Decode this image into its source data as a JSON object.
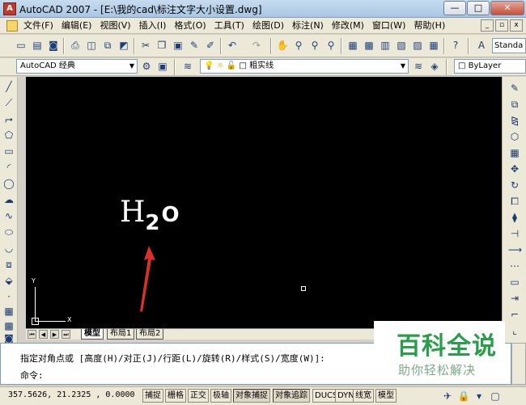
{
  "window": {
    "app_name": "AutoCAD 2007",
    "file_path": "[E:\\我的cad\\标注文字大小设置.dwg]",
    "minimize": "—",
    "maximize": "□",
    "close": "✕"
  },
  "menu": {
    "items": [
      "文件(F)",
      "编辑(E)",
      "视图(V)",
      "插入(I)",
      "格式(O)",
      "工具(T)",
      "绘图(D)",
      "标注(N)",
      "修改(M)",
      "窗口(W)",
      "帮助(H)"
    ],
    "mdi_min": "_",
    "mdi_restore": "▫",
    "mdi_close": "x"
  },
  "toolbar": {
    "text_style": "Standa",
    "workspace": "AutoCAD 经典",
    "layer": "粗实线",
    "color": "ByLayer"
  },
  "canvas": {
    "ucs_y": "Y",
    "ucs_x": "X",
    "text_big": "H",
    "text_sub": "2",
    "text_o": "O",
    "arrow_color": "#d9302a",
    "background": "#000000"
  },
  "tabs": [
    "模型",
    "布局1",
    "布局2"
  ],
  "command": {
    "prompt": "指定对角点或 [高度(H)/对正(J)/行距(L)/旋转(R)/样式(S)/宽度(W)]:",
    "input_label": "命令:"
  },
  "status": {
    "coords": "357.5626, 21.2325 , 0.0000",
    "buttons": [
      "捕捉",
      "栅格",
      "正交",
      "极轴",
      "对象捕捉",
      "对象追踪",
      "DUCS",
      "DYN",
      "线宽",
      "模型"
    ]
  },
  "watermark": {
    "logo": "百科全说",
    "subtitle": "助你轻松解决"
  }
}
